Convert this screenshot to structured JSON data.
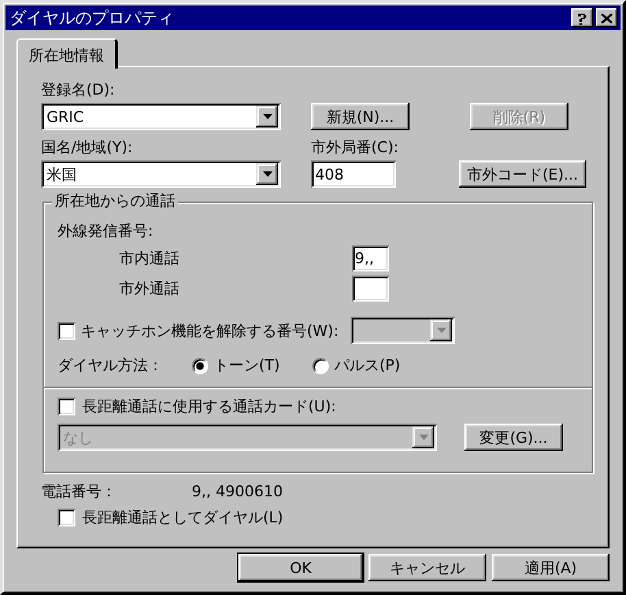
{
  "window": {
    "title": "ダイヤルのプロパティ"
  },
  "tabs": [
    {
      "label": "所在地情報",
      "selected": true
    }
  ],
  "location": {
    "label": "登録名(D):",
    "value": "GRIC"
  },
  "new_button": {
    "label": "新規(N)...",
    "disabled": false
  },
  "delete_button": {
    "label": "削除(R)",
    "disabled": true
  },
  "country": {
    "label": "国名/地域(Y):",
    "value": "米国"
  },
  "area_code": {
    "label": "市外局番(C):",
    "value": "408"
  },
  "area_code_button": {
    "label": "市外コード(E)...",
    "disabled": false
  },
  "dialing_group": {
    "title": "所在地からの通話",
    "outside_line_label": "外線発信番号:",
    "local": {
      "label": "市内通話",
      "value": "9,,"
    },
    "long_distance": {
      "label": "市外通話"
    },
    "call_waiting": {
      "label": "キャッチホン機能を解除する番号(W):",
      "checked": false,
      "disabled": true
    },
    "dial_method": {
      "label": "ダイヤル方法：",
      "options": [
        {
          "label": "トーン(T)",
          "selected": true
        },
        {
          "label": "パルス(P)",
          "selected": false
        }
      ]
    },
    "calling_card": {
      "label": "長距離通話に使用する通話カード(U):",
      "checked": false,
      "value": "なし",
      "disabled": true,
      "button": {
        "label": "変更(G)...",
        "disabled": false
      }
    }
  },
  "phone_number": {
    "label": "電話番号：",
    "value": "9,, 4900610"
  },
  "dial_long_distance": {
    "label": "長距離通話としてダイヤル(L)",
    "checked": false
  },
  "buttons": [
    {
      "label": "OK",
      "disabled": false
    },
    {
      "label": "キャンセル",
      "disabled": false
    },
    {
      "label": "適用(A)",
      "disabled": false
    }
  ]
}
